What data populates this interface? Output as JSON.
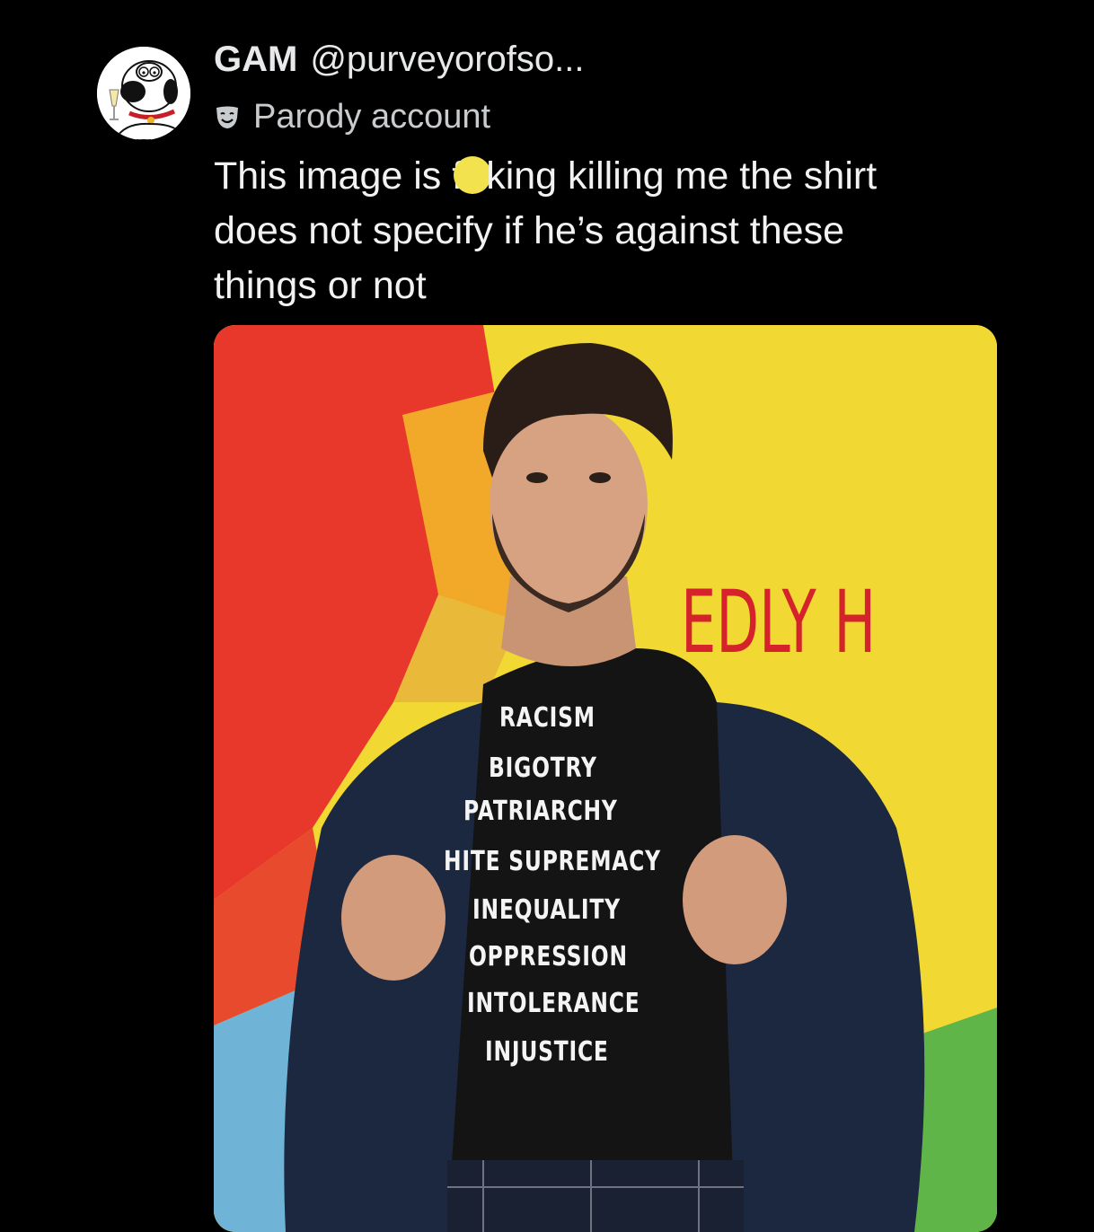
{
  "author": {
    "display_name": "GAM",
    "handle": "@purveyorofso...",
    "label": "Parody account",
    "avatar_icon": "family-guy-dog-avatar",
    "label_icon": "theater-mask-icon"
  },
  "tweet": {
    "text_part1": "This image is f",
    "text_part2": "king killing me the shirt",
    "line2": "does not specify if he’s against these",
    "line3": "things or not",
    "censor_color": "#f2e34e"
  },
  "media": {
    "wall_text": "EDLY H",
    "shirt_lines": [
      "RACISM",
      "BIGOTRY",
      "PATRIARCHY",
      "HITE SUPREMACY",
      "INEQUALITY",
      "OPPRESSION",
      "INTOLERANCE",
      "INJUSTICE"
    ],
    "colors": {
      "yellow": "#f1d832",
      "red": "#e8382c",
      "green": "#5fb548",
      "blue": "#6fb3d6",
      "jacket": "#1c2740"
    }
  }
}
